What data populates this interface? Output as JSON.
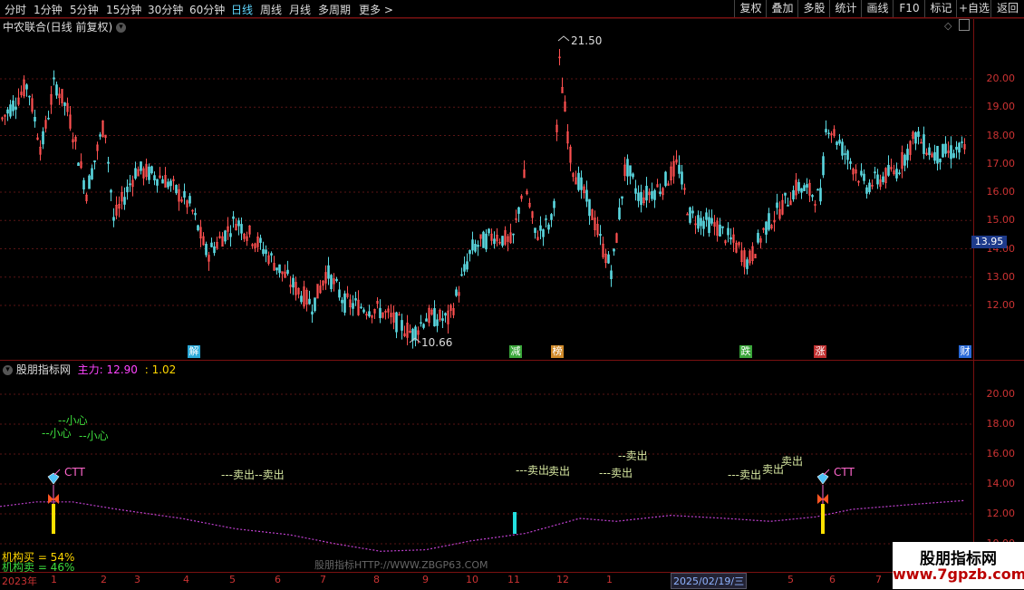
{
  "toolbar": {
    "timeframes": [
      "分时",
      "1分钟",
      "5分钟",
      "15分钟",
      "30分钟",
      "60分钟",
      "日线",
      "周线",
      "月线",
      "多周期",
      "更多 >"
    ],
    "active_index": 6,
    "right_buttons": [
      "复权",
      "叠加",
      "多股",
      "统计",
      "画线",
      "F10",
      "标记",
      "+自选",
      "返回"
    ]
  },
  "price_panel": {
    "title": "中农联合(日线 前复权)",
    "y_ticks": [
      "20.00",
      "19.00",
      "18.00",
      "17.00",
      "16.00",
      "15.00",
      "14.00",
      "13.00",
      "12.00"
    ],
    "y_range": [
      11.0,
      21.5
    ],
    "current_price": "13.95",
    "high_label": "21.50",
    "low_label": "10.66",
    "event_markers": [
      {
        "label": "解",
        "color": "#2aa9d8"
      },
      {
        "label": "减",
        "color": "#3aa63a"
      },
      {
        "label": "榜",
        "color": "#d08a2a"
      },
      {
        "label": "跌",
        "color": "#3aa63a"
      },
      {
        "label": "涨",
        "color": "#c03030"
      },
      {
        "label": "财",
        "color": "#2a6ad8"
      }
    ]
  },
  "indicator_panel": {
    "site": "股朋指标网",
    "main_label": "主力:",
    "main_value": "12.90",
    "extra_value": ": 1.02",
    "y_ticks": [
      "20.00",
      "18.00",
      "16.00",
      "14.00",
      "12.00",
      "10.00"
    ],
    "y_range": [
      9.5,
      21.5
    ],
    "caution_labels": [
      "--小心",
      "--小心",
      "--小心"
    ],
    "ctt_label": "CTT",
    "sell_labels": [
      "---卖出",
      "--卖出",
      "---卖出",
      "卖出",
      "---卖出",
      "--卖出",
      "---卖出",
      "卖出",
      "卖出"
    ],
    "inst_buy": "机构买 = 54%",
    "inst_sell": "机构卖 = 46%",
    "url_watermark": "股朋指标HTTP://WWW.ZBGP63.COM",
    "colors": {
      "line": "#c040d0",
      "caution": "#3ddc3d",
      "sell": "#d6e6a0",
      "inst_buy": "#ffd700",
      "inst_sell": "#3ddc3d",
      "bar_yellow": "#ffe000",
      "bar_cyan": "#22e0e0"
    }
  },
  "date_axis": {
    "labels": [
      "2023年",
      "1",
      "2",
      "3",
      "4",
      "5",
      "6",
      "7",
      "8",
      "9",
      "10",
      "11",
      "12",
      "1",
      "2025/02/19/三",
      "5",
      "6",
      "7"
    ]
  },
  "watermark": {
    "line1": "股朋指标网",
    "line2": "www.7gpzb.com"
  }
}
